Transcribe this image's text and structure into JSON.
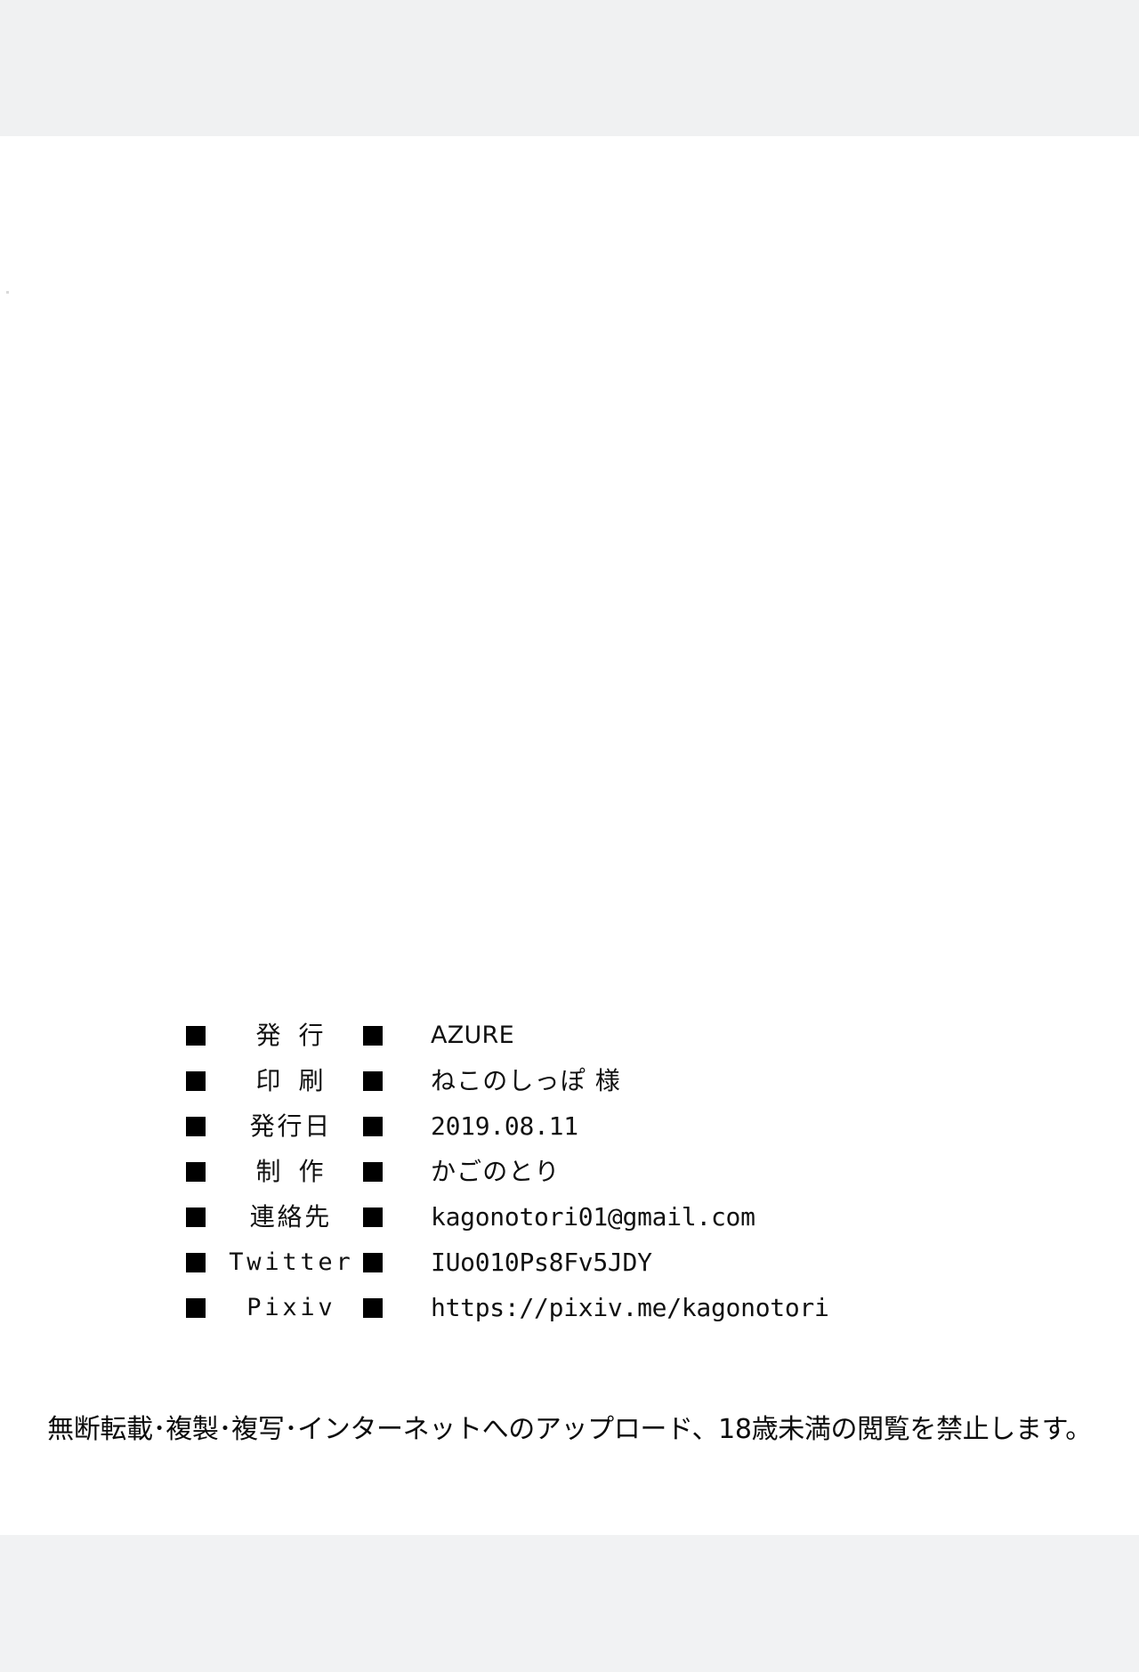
{
  "page": {
    "background_color": "#ffffff",
    "scan_band_color": "#f0f1f2",
    "ink_color": "#000000"
  },
  "colophon": {
    "bullet_glyph": "square",
    "rows": [
      {
        "label": "発 行",
        "label_kind": "jp",
        "value": "AZURE",
        "value_kind": "brand"
      },
      {
        "label": "印 刷",
        "label_kind": "jp",
        "value": "ねこのしっぽ 様",
        "value_kind": "jp"
      },
      {
        "label": "発行日",
        "label_kind": "jp",
        "value": "2019.08.11",
        "value_kind": "mono"
      },
      {
        "label": "制 作",
        "label_kind": "jp",
        "value": "かごのとり",
        "value_kind": "jp"
      },
      {
        "label": "連絡先",
        "label_kind": "jp",
        "value": "kagonotori01@gmail.com",
        "value_kind": "mono"
      },
      {
        "label": "Twitter",
        "label_kind": "latin",
        "value": "IUo010Ps8Fv5JDY",
        "value_kind": "mono"
      },
      {
        "label": "Pixiv",
        "label_kind": "latin",
        "value": "https://pixiv.me/kagonotori",
        "value_kind": "mono"
      }
    ]
  },
  "warning": {
    "text": "無断転載･複製･複写･インターネットへのアップロード、18歳未満の閲覧を禁止します。"
  }
}
